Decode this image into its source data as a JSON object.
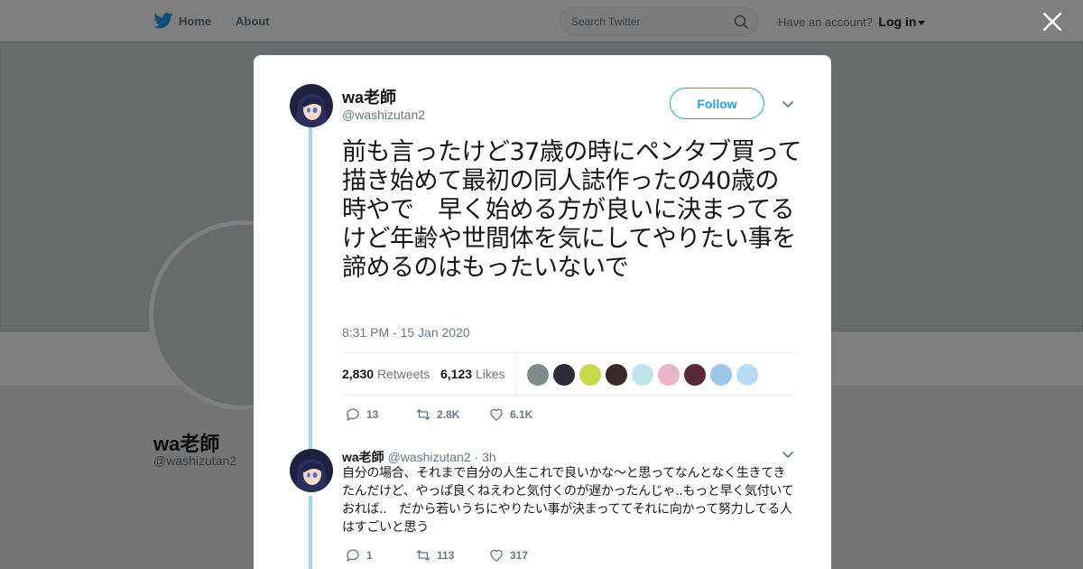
{
  "nav": {
    "home_label": "Home",
    "about_label": "About",
    "search_placeholder": "Search Twitter",
    "account_prompt": "Have an account?",
    "login_label": "Log in"
  },
  "profile": {
    "name": "wa老師",
    "handle": "@washizutan2"
  },
  "tweet": {
    "author_name": "wa老師",
    "author_handle": "@washizutan2",
    "follow_label": "Follow",
    "text": "前も言ったけど37歳の時にペンタブ買って描き始めて最初の同人誌作ったの40歳の時やで　早く始める方が良いに決まってるけど年齢や世間体を気にしてやりたい事を諦めるのはもったいないで",
    "timestamp": "8:31 PM - 15 Jan 2020",
    "retweets_count": "2,830",
    "retweets_label": "Retweets",
    "likes_count": "6,123",
    "likes_label": "Likes",
    "actions": {
      "replies": "13",
      "retweets": "2.8K",
      "likes": "6.1K"
    },
    "liker_avatar_colors": [
      "#7f8c8d",
      "#2c2c3a",
      "#c8d84a",
      "#3a2a2a",
      "#bfe3ea",
      "#e8b4c8",
      "#5a2a3a",
      "#9cc6e8",
      "#b8dcf4"
    ]
  },
  "reply": {
    "author_name": "wa老師",
    "author_handle": "@washizutan2",
    "separator": "·",
    "time": "3h",
    "text": "自分の場合、それまで自分の人生これで良いかな～と思ってなんとなく生きてきたんだけど、やっぱ良くねえわと気付くのが遅かったんじゃ..もっと早く気付いておれば..　だから若いうちにやりたい事が決まっててそれに向かって努力してる人はすごいと思う",
    "actions": {
      "replies": "1",
      "retweets": "113",
      "likes": "317"
    }
  },
  "colors": {
    "brand": "#1da1f2",
    "thread_line": "#9fd6f2",
    "muted_text": "#657786"
  },
  "icons": [
    "twitter-bird-icon",
    "search-icon",
    "close-icon",
    "chevron-down-icon",
    "reply-icon",
    "retweet-icon",
    "like-icon"
  ]
}
